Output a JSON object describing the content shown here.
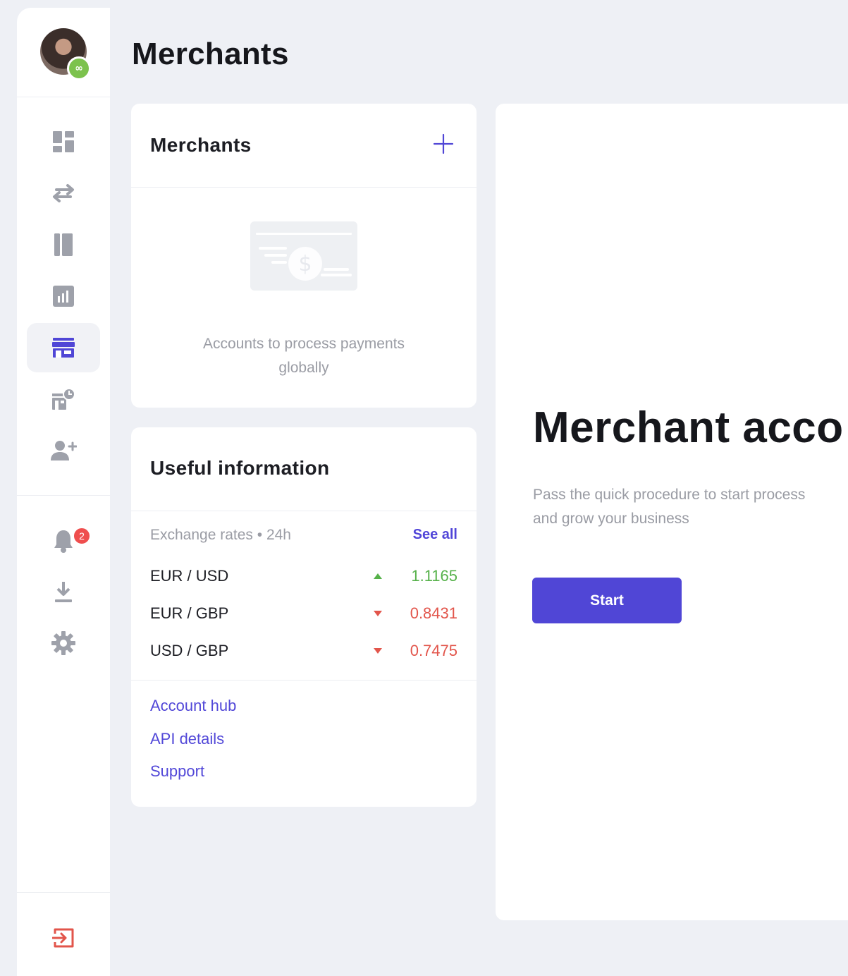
{
  "page": {
    "title": "Merchants"
  },
  "sidebar": {
    "avatar": {
      "badge_glyph": "∞"
    },
    "nav": [
      {
        "icon": "dashboard-icon"
      },
      {
        "icon": "transfer-arrows-icon"
      },
      {
        "icon": "cards-icon"
      },
      {
        "icon": "statistics-icon"
      },
      {
        "icon": "store-icon",
        "active": true
      },
      {
        "icon": "merchant-clock-icon"
      },
      {
        "icon": "add-user-icon"
      }
    ],
    "notifications": {
      "icon": "bell-icon",
      "count": "2"
    },
    "download": {
      "icon": "download-icon"
    },
    "settings": {
      "icon": "gear-icon"
    },
    "logout": {
      "icon": "logout-icon"
    }
  },
  "merchants_card": {
    "title": "Merchants",
    "add_icon": "plus-icon",
    "empty_text_line1": "Accounts to process payments",
    "empty_text_line2": "globally"
  },
  "info_card": {
    "title": "Useful information",
    "rates_label": "Exchange rates • 24h",
    "see_all": "See all",
    "rates": [
      {
        "pair": "EUR / USD",
        "direction": "up",
        "value": "1.1165"
      },
      {
        "pair": "EUR / GBP",
        "direction": "down",
        "value": "0.8431"
      },
      {
        "pair": "USD / GBP",
        "direction": "down",
        "value": "0.7475"
      }
    ],
    "links": [
      "Account hub",
      "API details",
      "Support"
    ]
  },
  "main_card": {
    "heading": "Merchant acco",
    "sub_line1": "Pass the quick procedure to start process",
    "sub_line2": "and grow your business",
    "start_label": "Start"
  },
  "colors": {
    "accent": "#5046d6",
    "up": "#56b14a",
    "down": "#e2554b",
    "badge": "#ef4e4e",
    "avatar_badge": "#7cc24d"
  }
}
